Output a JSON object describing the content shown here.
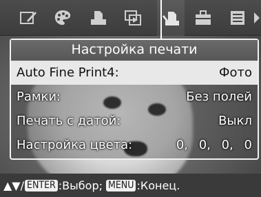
{
  "menu": {
    "title": "Настройка печати",
    "rows": [
      {
        "label": "Auto Fine Print4:",
        "value": "Фото"
      },
      {
        "label": "Рамки:",
        "value": "Без полей"
      },
      {
        "label": "Печать с датой:",
        "value": "Выкл"
      },
      {
        "label": "Настройка цвета:",
        "value": "0, 0, 0, 0"
      }
    ]
  },
  "icons": [
    "edit-icon",
    "palette-icon",
    "print-icon",
    "slideshow-icon",
    "print-settings-icon",
    "toolbox-icon",
    "list-icon"
  ],
  "hint": {
    "arrows": "▲▼/",
    "enter_key": "ENTER",
    "enter_text": ":Выбор;",
    "menu_key": "MENU",
    "menu_text": ":Конец."
  }
}
